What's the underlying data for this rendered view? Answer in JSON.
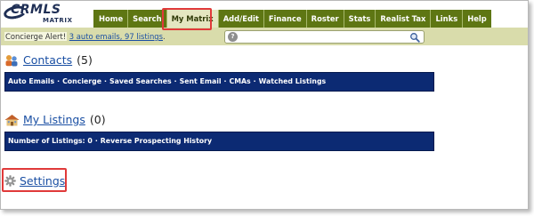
{
  "logo": {
    "brand": "CRMLS",
    "product": "MATRIX"
  },
  "nav": {
    "tabs": [
      {
        "label": "Home"
      },
      {
        "label": "Search"
      },
      {
        "label": "My Matrix"
      },
      {
        "label": "Add/Edit"
      },
      {
        "label": "Finance"
      },
      {
        "label": "Roster"
      },
      {
        "label": "Stats"
      },
      {
        "label": "Realist Tax"
      },
      {
        "label": "Links"
      },
      {
        "label": "Help"
      }
    ],
    "active": "My Matrix"
  },
  "alert": {
    "label": "Concierge Alert!",
    "link_text": "3 auto emails, 97 listings",
    "suffix": "."
  },
  "search": {
    "help_glyph": "?",
    "placeholder": "",
    "value": "",
    "icon": "magnifier-icon"
  },
  "contacts": {
    "title": "Contacts",
    "count": "(5)",
    "icon": "contacts-icon",
    "links": [
      "Auto Emails",
      "Concierge",
      "Saved Searches",
      "Sent Email",
      "CMAs",
      "Watched Listings"
    ]
  },
  "listings": {
    "title": "My Listings",
    "count": "(0)",
    "icon": "house-icon",
    "links": [
      "Number of Listings: 0",
      "Reverse Prospecting History"
    ]
  },
  "settings": {
    "title": "Settings",
    "icon": "gear-icon"
  },
  "separator": "·",
  "colors": {
    "nav_bg": "#5e7613",
    "nav_active_bg": "#e4e6c1",
    "alert_bg": "#d9dcab",
    "link_bar_bg": "#0c2a73",
    "link_blue": "#1a4fa3",
    "highlight_red": "#e03a3a"
  }
}
